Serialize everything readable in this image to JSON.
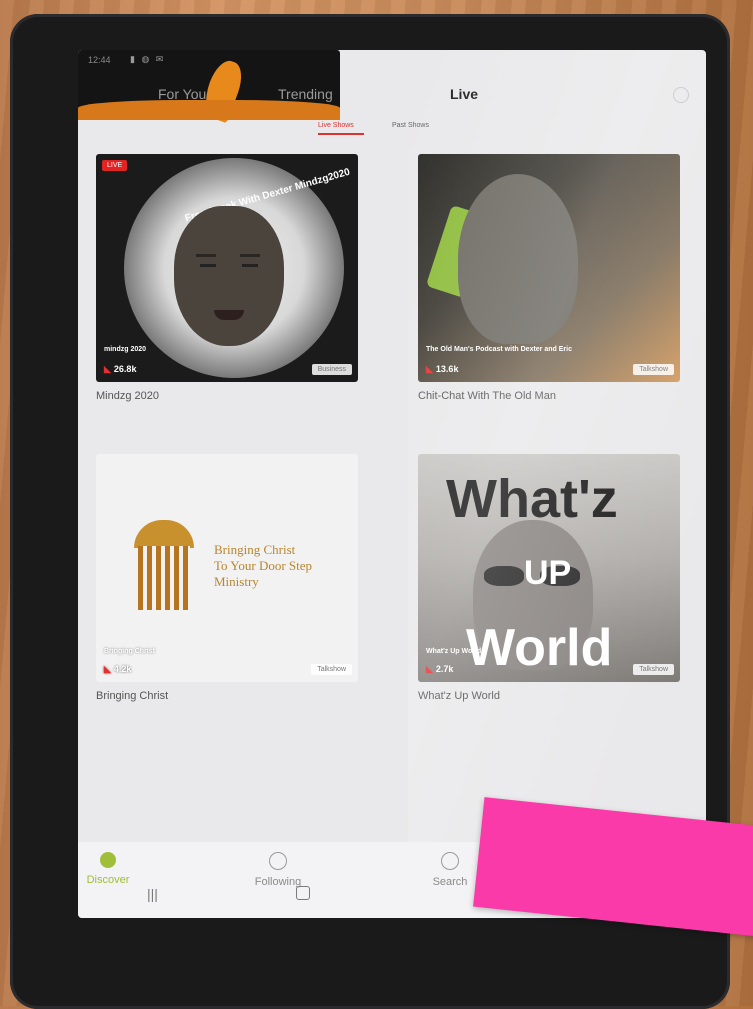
{
  "status_bar": {
    "time": "12:44",
    "icons": "▮ ◍ ✉"
  },
  "top_tabs": [
    {
      "label": "For You"
    },
    {
      "label": "Trending"
    },
    {
      "label": "Live"
    }
  ],
  "sub_tabs": {
    "live_shows": "Live Shows",
    "past_shows": "Past Shows"
  },
  "cards": [
    {
      "title": "Mindzg 2020",
      "caption": "mindzg 2020",
      "views": "26.8k",
      "badge": "Business",
      "live_label": "LIVE",
      "ring_text": "Free Speak With Dexter Mindzg2020"
    },
    {
      "title": "Chit-Chat With The Old Man",
      "caption": "The Old Man's Podcast with Dexter and Eric",
      "views": "13.6k",
      "badge": "Talkshow"
    },
    {
      "title": "Bringing Christ",
      "caption": "Bringing Christ",
      "views": "4.2k",
      "badge": "Talkshow",
      "ministry_lines": [
        "Bringing Christ",
        "To Your Door Step",
        "Ministry"
      ]
    },
    {
      "title": "What'z Up World",
      "caption": "What'z Up World",
      "views": "2.7k",
      "badge": "Talkshow",
      "overlay_lines": [
        "What'z",
        "UP",
        "World"
      ]
    }
  ],
  "bottom_nav": [
    {
      "label": "Discover",
      "icon": "compass-icon"
    },
    {
      "label": "Following",
      "icon": "following-icon"
    },
    {
      "label": "Search",
      "icon": "search-icon"
    }
  ],
  "system_nav": {
    "back": "|||"
  },
  "colors": {
    "accent_green": "#9fbe3a",
    "live_red": "#e02424",
    "sticky_pink": "#f93aa8"
  }
}
